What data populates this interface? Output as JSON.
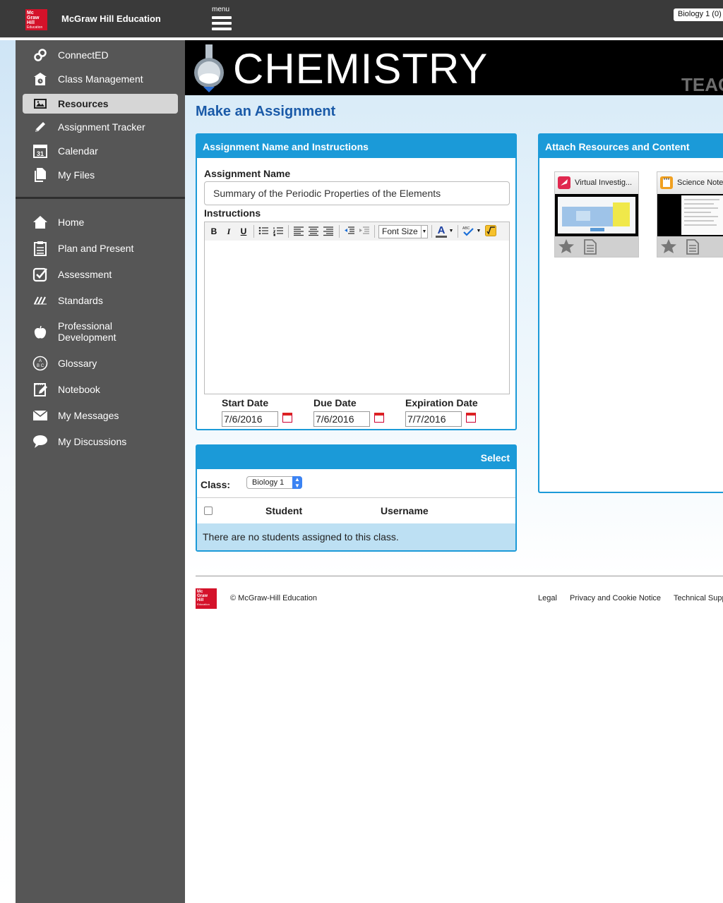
{
  "header": {
    "brand": "McGraw Hill Education",
    "logo_lines": [
      "Mc",
      "Graw",
      "Hill",
      "Education"
    ],
    "menu_label": "menu",
    "class_selector": "Biology 1 (0)"
  },
  "sidebar": {
    "primary": [
      {
        "label": "ConnectED",
        "icon": "link-icon"
      },
      {
        "label": "Class Management",
        "icon": "schoolhouse-icon"
      },
      {
        "label": "Resources",
        "icon": "image-icon",
        "active": true
      },
      {
        "label": "Assignment Tracker",
        "icon": "pencil-icon"
      },
      {
        "label": "Calendar",
        "icon": "calendar-icon"
      },
      {
        "label": "My Files",
        "icon": "files-icon"
      }
    ],
    "secondary": [
      {
        "label": "Home",
        "icon": "home-icon"
      },
      {
        "label": "Plan and Present",
        "icon": "clipboard-icon"
      },
      {
        "label": "Assessment",
        "icon": "checkbox-icon"
      },
      {
        "label": "Standards",
        "icon": "slashes-icon"
      },
      {
        "label": "Professional Development",
        "line1": "Professional",
        "line2": "Development",
        "icon": "apple-icon"
      },
      {
        "label": "Glossary",
        "icon": "abc-icon"
      },
      {
        "label": "Notebook",
        "icon": "notebook-icon"
      },
      {
        "label": "My Messages",
        "icon": "envelope-icon"
      },
      {
        "label": "My Discussions",
        "icon": "speech-bubble-icon"
      }
    ]
  },
  "banner": {
    "subject": "CHEMISTRY",
    "overflow_text": "TEAC"
  },
  "main": {
    "page_title": "Make an Assignment",
    "assignment_panel": {
      "header": "Assignment Name and Instructions",
      "name_label": "Assignment Name",
      "name_value": "Summary of the Periodic Properties of the Elements",
      "instructions_label": "Instructions",
      "toolbar": {
        "bold": "B",
        "italic": "I",
        "underline": "U",
        "font_size": "Font Size",
        "font_color": "A"
      },
      "dates": {
        "start_label": "Start Date",
        "start_value": "7/6/2016",
        "due_label": "Due Date",
        "due_value": "7/6/2016",
        "expiration_label": "Expiration Date",
        "expiration_value": "7/7/2016"
      }
    },
    "select_panel": {
      "header": "Select",
      "class_label": "Class:",
      "class_value": "Biology 1",
      "columns": [
        "Student",
        "Username"
      ],
      "empty_message": "There are no students assigned to this class."
    },
    "resources_panel": {
      "header": "Attach Resources and Content",
      "cards": [
        {
          "title": "Virtual Investig...",
          "icon": "flask-icon",
          "accent": "#e0284f"
        },
        {
          "title": "Science Notebook",
          "icon": "notebook-icon",
          "accent": "#f0a020"
        }
      ]
    }
  },
  "footer": {
    "copyright": "© McGraw-Hill Education",
    "links": [
      "Legal",
      "Privacy and Cookie Notice",
      "Technical Support"
    ]
  },
  "colors": {
    "accent_blue": "#1b9ad8",
    "title_blue": "#1a5aa8",
    "sidebar_bg": "#565656",
    "brand_red": "#d4122a"
  }
}
